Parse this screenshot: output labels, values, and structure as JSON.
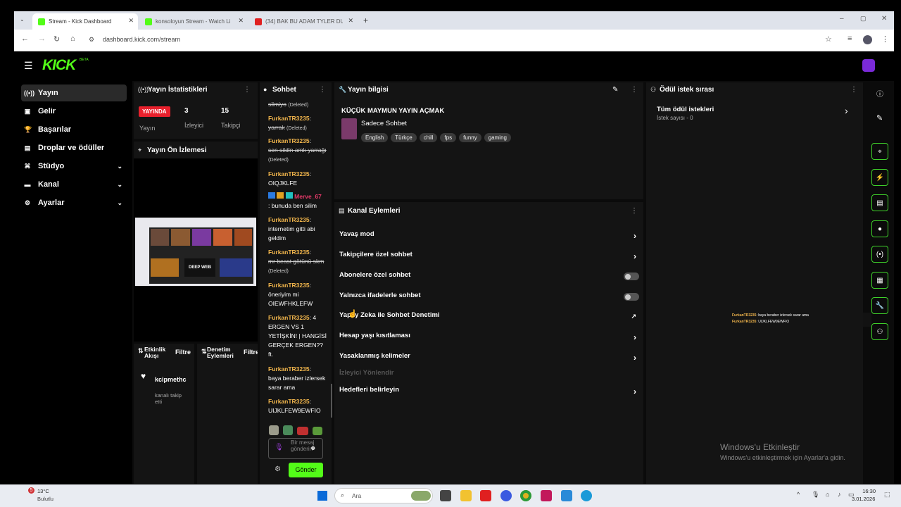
{
  "browser": {
    "tabs": [
      {
        "title": "Stream - Kick Dashboard",
        "active": true
      },
      {
        "title": "konsoloyun Stream - Watch Li",
        "active": false
      },
      {
        "title": "(34) BAK BU ADAM TYLER DUR",
        "active": false
      }
    ],
    "url": "dashboard.kick.com/stream"
  },
  "app": {
    "logo": "KICK",
    "logo_badge": "BETA",
    "accent": "#53fc18"
  },
  "sidebar": {
    "items": [
      {
        "label": "Yayın",
        "icon": "broadcast-icon"
      },
      {
        "label": "Gelir",
        "icon": "money-icon"
      },
      {
        "label": "Başarılar",
        "icon": "trophy-icon"
      },
      {
        "label": "Droplar ve ödüller",
        "icon": "drops-icon"
      },
      {
        "label": "Stüdyo",
        "icon": "studio-icon"
      },
      {
        "label": "Kanal",
        "icon": "channel-icon"
      },
      {
        "label": "Ayarlar",
        "icon": "settings-icon"
      }
    ]
  },
  "stats": {
    "title": "Yayın İstatistikleri",
    "live_badge": "YAYINDA",
    "viewers": "3",
    "followers": "15",
    "live_label": "Yayın",
    "viewers_label": "İzleyici",
    "followers_label": "Takipçi"
  },
  "preview": {
    "title": "Yayın Ön İzlemesi",
    "overlay_text": "DEEP WEB"
  },
  "activity": {
    "title": "Etkinlik Akışı",
    "filter": "Filtre",
    "user": "kcipmethc",
    "event": "kanalı takip etti"
  },
  "mod": {
    "title": "Denetim Eylemleri",
    "filter": "Filtre"
  },
  "chat": {
    "title": "Sohbet",
    "messages": [
      {
        "user": "",
        "text": "silmiyo",
        "deleted": true,
        "note": "(Deleted)"
      },
      {
        "user": "FurkanTR3235",
        "text": "yarrak",
        "deleted": true,
        "note": "(Deleted)"
      },
      {
        "user": "FurkanTR3235",
        "text": "sen sildin amk yarrağı",
        "deleted": true,
        "note": "(Deleted)"
      },
      {
        "user": "FurkanTR3235",
        "text": "OIQJKLFE",
        "deleted": false,
        "note": ""
      },
      {
        "user": "Merve_67",
        "text": "bunuda ben silim",
        "deleted": false,
        "note": ""
      },
      {
        "user": "FurkanTR3235",
        "text": "internetim gitti abi geldim",
        "deleted": false,
        "note": ""
      },
      {
        "user": "FurkanTR3235",
        "text": "mr beast götünü skm",
        "deleted": true,
        "note": "(Deleted)"
      },
      {
        "user": "FurkanTR3235",
        "text": "öneriyim mi OIEWFHKLEFW",
        "deleted": false,
        "note": ""
      },
      {
        "user": "FurkanTR3235",
        "text": "4 ERGEN VS 1 YETİŞKİN! | HANGİSİ GERÇEK ERGEN?? ft.",
        "deleted": false,
        "note": ""
      },
      {
        "user": "FurkanTR3235",
        "text": "baya beraber izlersek sarar ama",
        "deleted": false,
        "note": ""
      },
      {
        "user": "FurkanTR3235",
        "text": "UIJKLFEW9EWFIO",
        "deleted": false,
        "note": ""
      }
    ],
    "input_placeholder": "Bir mesaj gönderin",
    "send_label": "Gönder"
  },
  "stream_info": {
    "title": "Yayın bilgisi",
    "stream_title": "KÜÇÜK MAYMUN YAYIN AÇMAK",
    "category": "Sadece Sohbet",
    "tags": [
      "English",
      "Türkçe",
      "chill",
      "fps",
      "funny",
      "gaming"
    ]
  },
  "channel_actions": {
    "title": "Kanal Eylemleri",
    "items": [
      {
        "label": "Yavaş mod",
        "control": "arrow"
      },
      {
        "label": "Takipçilere özel sohbet",
        "control": "arrow"
      },
      {
        "label": "Abonelere özel sohbet",
        "control": "toggle",
        "on": false
      },
      {
        "label": "Yalnızca ifadelerle sohbet",
        "control": "toggle",
        "on": false
      },
      {
        "label": "Yapay Zeka ile Sohbet Denetimi",
        "control": "external"
      },
      {
        "label": "Hesap yaşı kısıtlaması",
        "control": "arrow"
      },
      {
        "label": "Yasaklanmış kelimeler",
        "control": "arrow"
      },
      {
        "label": "İzleyici Yönlendir",
        "control": "disabled"
      },
      {
        "label": "Hedefleri belirleyin",
        "control": "arrow"
      }
    ]
  },
  "rewards": {
    "title": "Ödül istek sırası",
    "all_label": "Tüm ödül istekleri",
    "count_label": "İstek sayısı - 0"
  },
  "overlay_chat": [
    {
      "user": "FurkanTR3235",
      "text": ": baya beraber izlersek sarar ama"
    },
    {
      "user": "FurkanTR3235",
      "text": ": UIJKLFEW9EWFIO"
    }
  ],
  "watermark": {
    "line1": "Windows'u Etkinleştir",
    "line2": "Windows'u etkinleştirmek için Ayarlar'a gidin."
  },
  "taskbar": {
    "weather_badge": "5",
    "temperature": "13°C",
    "weather": "Bulutlu",
    "search": "Ara",
    "time": "16:30",
    "date": "3.01.2026"
  }
}
